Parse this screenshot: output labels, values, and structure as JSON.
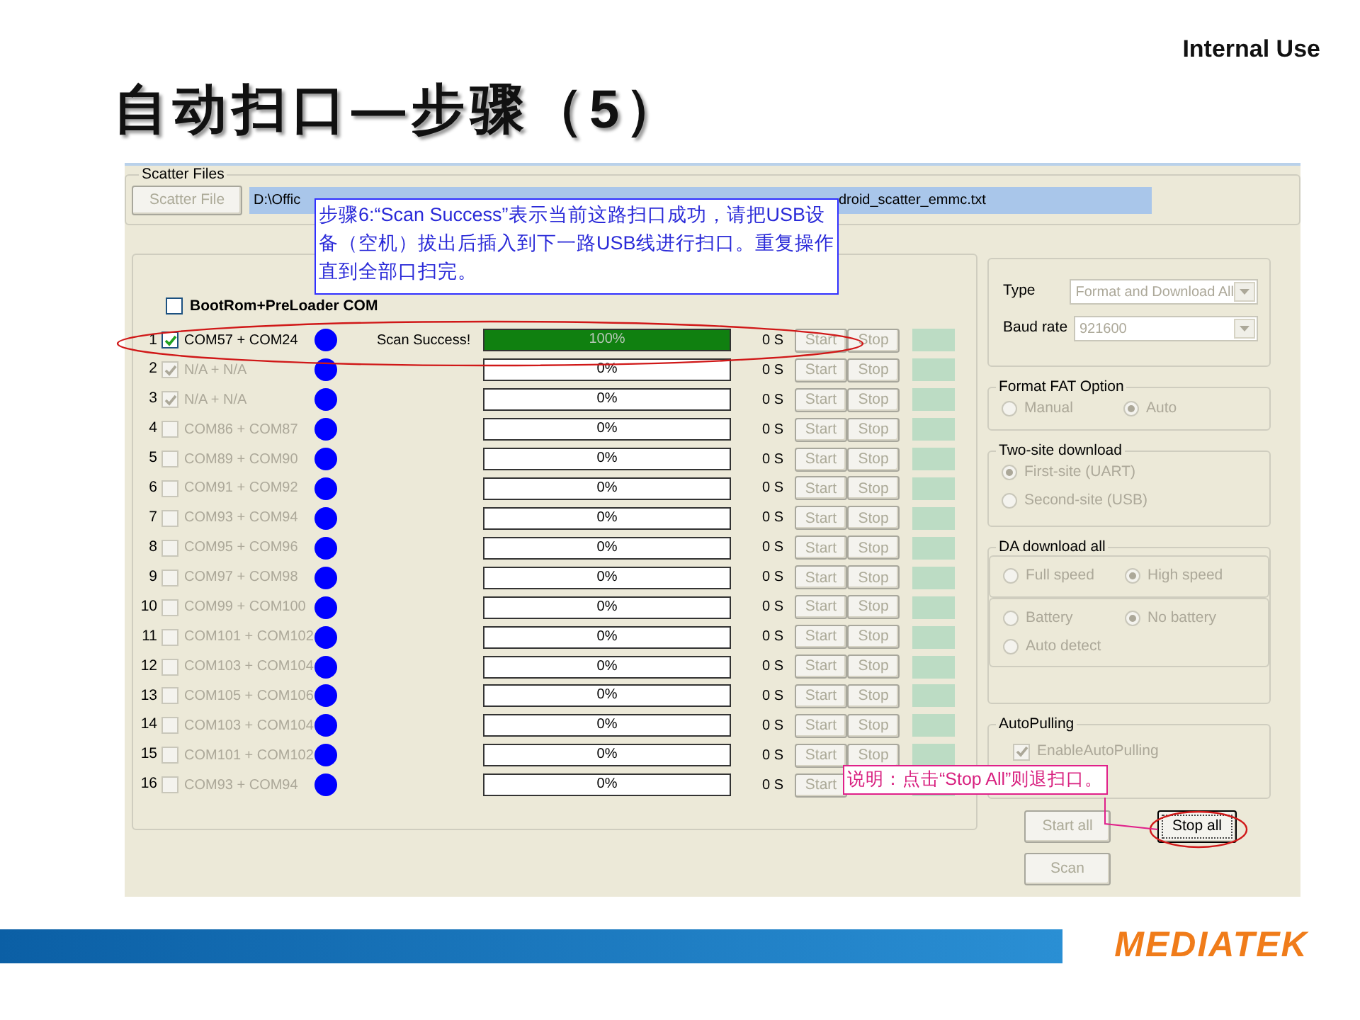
{
  "header": {
    "label": "Internal Use"
  },
  "title": "自动扫口—步骤（5）",
  "scatter_files": {
    "legend": "Scatter Files",
    "button": "Scatter File",
    "button_disabled": true,
    "path_start": "D:\\Offic",
    "path_end": "droid_scatter_emmc.txt"
  },
  "bootrom": {
    "label": "BootRom+PreLoader COM",
    "checked": false
  },
  "ports": [
    {
      "number": "1",
      "label": "COM57 + COM24",
      "checked": true,
      "disabled": false,
      "status": "Scan Success!",
      "level": 1,
      "percent": "100%",
      "time": "0 S",
      "start": "Start",
      "stop": "Stop"
    },
    {
      "number": "2",
      "label": "N/A + N/A",
      "checked": true,
      "disabled": true,
      "level": 0,
      "percent": "0%",
      "time": "0 S",
      "start": "Start",
      "stop": "Stop"
    },
    {
      "number": "3",
      "label": "N/A + N/A",
      "checked": true,
      "disabled": true,
      "level": 0,
      "percent": "0%",
      "time": "0 S",
      "start": "Start",
      "stop": "Stop"
    },
    {
      "number": "4",
      "label": "COM86 + COM87",
      "checked": false,
      "disabled": true,
      "level": 0,
      "percent": "0%",
      "time": "0 S",
      "start": "Start",
      "stop": "Stop"
    },
    {
      "number": "5",
      "label": "COM89 + COM90",
      "checked": false,
      "disabled": true,
      "level": 0,
      "percent": "0%",
      "time": "0 S",
      "start": "Start",
      "stop": "Stop"
    },
    {
      "number": "6",
      "label": "COM91 + COM92",
      "checked": false,
      "disabled": true,
      "level": 0,
      "percent": "0%",
      "time": "0 S",
      "start": "Start",
      "stop": "Stop"
    },
    {
      "number": "7",
      "label": "COM93 + COM94",
      "checked": false,
      "disabled": true,
      "level": 0,
      "percent": "0%",
      "time": "0 S",
      "start": "Start",
      "stop": "Stop"
    },
    {
      "number": "8",
      "label": "COM95 + COM96",
      "checked": false,
      "disabled": true,
      "level": 0,
      "percent": "0%",
      "time": "0 S",
      "start": "Start",
      "stop": "Stop"
    },
    {
      "number": "9",
      "label": "COM97 + COM98",
      "checked": false,
      "disabled": true,
      "level": 0,
      "percent": "0%",
      "time": "0 S",
      "start": "Start",
      "stop": "Stop"
    },
    {
      "number": "10",
      "label": "COM99 + COM100",
      "checked": false,
      "disabled": true,
      "level": 0,
      "percent": "0%",
      "time": "0 S",
      "start": "Start",
      "stop": "Stop"
    },
    {
      "number": "11",
      "label": "COM101 + COM102",
      "checked": false,
      "disabled": true,
      "level": 0,
      "percent": "0%",
      "time": "0 S",
      "start": "Start",
      "stop": "Stop"
    },
    {
      "number": "12",
      "label": "COM103 + COM104",
      "checked": false,
      "disabled": true,
      "level": 0,
      "percent": "0%",
      "time": "0 S",
      "start": "Start",
      "stop": "Stop"
    },
    {
      "number": "13",
      "label": "COM105 + COM106",
      "checked": false,
      "disabled": true,
      "level": 0,
      "percent": "0%",
      "time": "0 S",
      "start": "Start",
      "stop": "Stop"
    },
    {
      "number": "14",
      "label": "COM103 + COM104",
      "checked": false,
      "disabled": true,
      "level": 0,
      "percent": "0%",
      "time": "0 S",
      "start": "Start",
      "stop": "Stop"
    },
    {
      "number": "15",
      "label": "COM101 + COM102",
      "checked": false,
      "disabled": true,
      "level": 0,
      "percent": "0%",
      "time": "0 S",
      "start": "Start",
      "stop": "Stop"
    },
    {
      "number": "16",
      "label": "COM93 + COM94",
      "checked": false,
      "disabled": true,
      "level": 0,
      "percent": "0%",
      "time": "0 S",
      "start": "Start"
    }
  ],
  "settings": {
    "type_label": "Type",
    "type_value": "Format and Download All",
    "baud_label": "Baud rate",
    "baud_value": "921600",
    "disabled": true
  },
  "format_fat": {
    "legend": "Format FAT Option",
    "disabled": true,
    "options": [
      {
        "label": "Manual",
        "selected": false
      },
      {
        "label": "Auto",
        "selected": true
      }
    ]
  },
  "two_site": {
    "legend": "Two-site download",
    "disabled": true,
    "options": [
      {
        "label": "First-site (UART)",
        "selected": true
      },
      {
        "label": "Second-site (USB)",
        "selected": false
      }
    ]
  },
  "da_download": {
    "legend": "DA download all",
    "disabled": true,
    "speed": [
      {
        "label": "Full speed",
        "selected": false
      },
      {
        "label": "High speed",
        "selected": true
      }
    ],
    "battery": [
      {
        "label": "Battery",
        "selected": false
      },
      {
        "label": "No battery",
        "selected": true
      },
      {
        "label": "Auto detect",
        "selected": false
      }
    ]
  },
  "auto_pulling": {
    "legend": "AutoPulling",
    "label": "EnableAutoPulling",
    "checked": true,
    "disabled": true
  },
  "buttons": [
    {
      "label": "Start all",
      "disabled": true
    },
    {
      "label": "Stop all",
      "disabled": false
    },
    {
      "label": "Scan",
      "disabled": true
    }
  ],
  "annotations": {
    "step_note": "步骤6:“Scan Success”表示当前这路扫口成功，请把USB设备（空机）拔出后插入到下一路USB线进行扫口。重复操作直到全部口扫完。",
    "stop_note": "说明：点击“Stop All”则退扫口。"
  },
  "footer": {
    "logo": "MEDIATEK"
  }
}
